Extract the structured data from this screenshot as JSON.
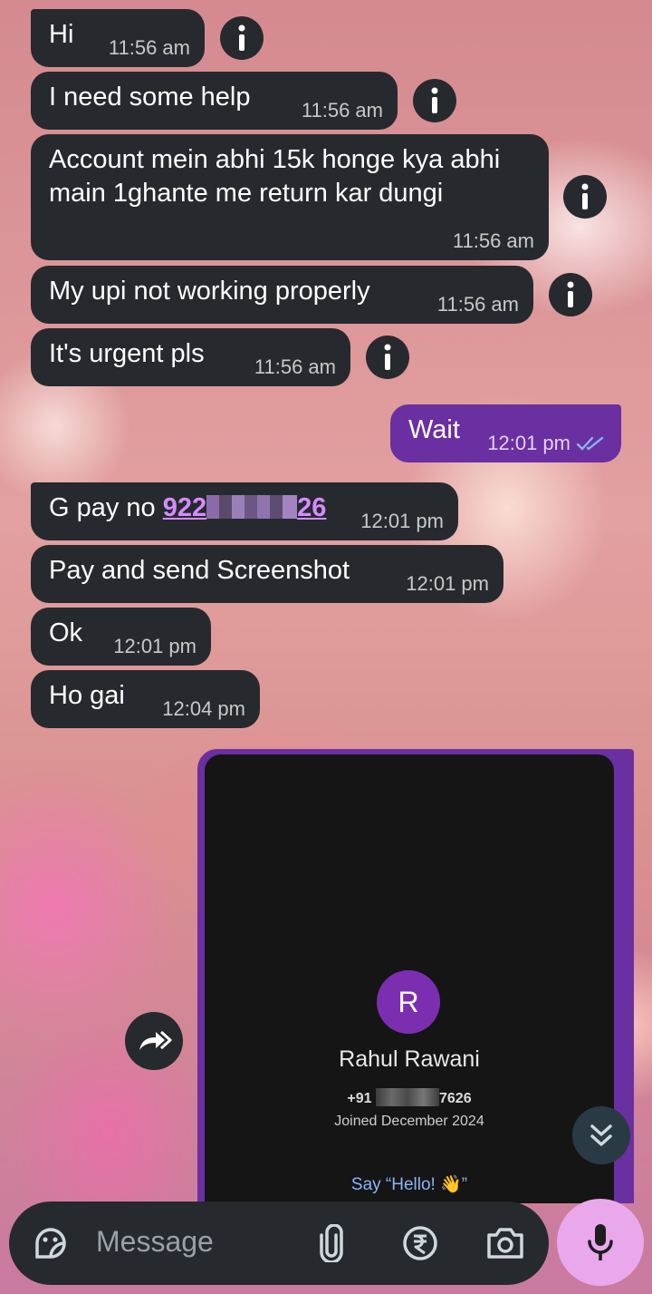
{
  "messages": [
    {
      "text": "Hi",
      "time": "11:56 am"
    },
    {
      "text": "I need some help",
      "time": "11:56 am"
    },
    {
      "text": "Account mein abhi 15k honge kya abhi main 1ghante me return kar dungi",
      "time": "11:56 am"
    },
    {
      "text": "My upi not working properly",
      "time": "11:56 am"
    },
    {
      "text": "It's urgent pls",
      "time": "11:56 am"
    },
    {
      "text": "Wait",
      "time": "12:01 pm",
      "status": "read"
    },
    {
      "prefix": "G pay no ",
      "link_start": "922",
      "link_end": "26",
      "time": "12:01 pm"
    },
    {
      "text": "Pay and send Screenshot",
      "time": "12:01 pm"
    },
    {
      "text": "Ok",
      "time": "12:01 pm"
    },
    {
      "text": "Ho gai",
      "time": "12:04 pm"
    }
  ],
  "screenshot": {
    "avatar_letter": "R",
    "name": "Rahul Rawani",
    "phone_prefix": "+91",
    "phone_suffix": "7626",
    "joined": "Joined December 2024",
    "say_hello": "Say “Hello! 👋”"
  },
  "composer": {
    "placeholder": "Message"
  },
  "icons": {
    "info": "info-icon",
    "forward": "forward-icon",
    "scroll": "scroll-down-icon",
    "sticker": "sticker-icon",
    "attach": "attach-icon",
    "payment": "rupee-icon",
    "camera": "camera-icon",
    "mic": "mic-icon"
  },
  "colors": {
    "incoming": "#262a2e",
    "outgoing": "#6a2fa0",
    "link": "#d48cff",
    "mic_button": "#e9a8ec"
  }
}
